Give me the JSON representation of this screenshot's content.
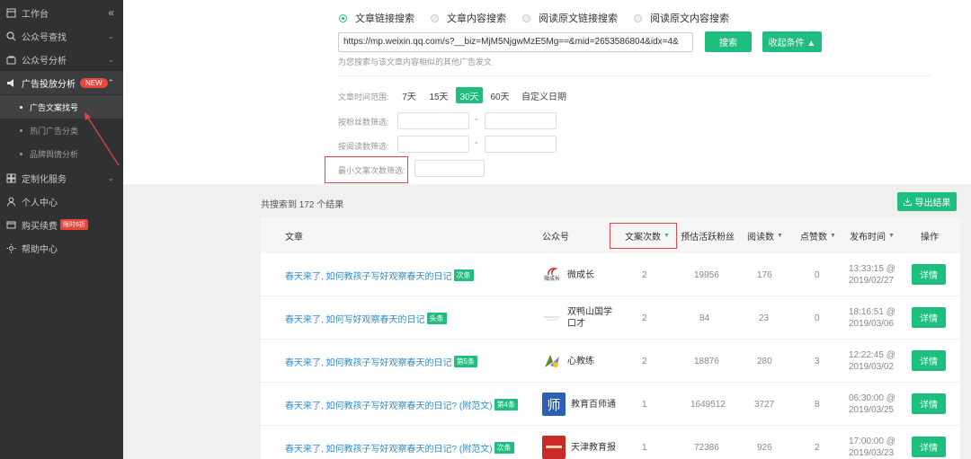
{
  "sidebar": {
    "items": [
      {
        "icon": "workbench-icon",
        "label": "工作台"
      },
      {
        "icon": "search-icon",
        "label": "公众号查找"
      },
      {
        "icon": "analysis-icon",
        "label": "公众号分析"
      },
      {
        "icon": "ad-icon",
        "label": "广告投放分析",
        "badge": "NEW"
      },
      {
        "icon": "custom-service-icon",
        "label": "定制化服务"
      },
      {
        "icon": "user-icon",
        "label": "个人中心"
      },
      {
        "icon": "cart-icon",
        "label": "购买续费",
        "badge": "限时6折"
      },
      {
        "icon": "help-icon",
        "label": "帮助中心"
      }
    ],
    "subitems": [
      {
        "label": "广告文案找号"
      },
      {
        "label": "热门广告分类"
      },
      {
        "label": "品牌舆情分析"
      }
    ],
    "collapse_glyph": "«"
  },
  "search": {
    "modes": [
      "文章链接搜索",
      "文章内容搜索",
      "阅读原文链接搜索",
      "阅读原文内容搜索"
    ],
    "url_value": "https://mp.weixin.qq.com/s?__biz=MjM5NjgwMzE5Mg==&mid=2653586804&idx=4&",
    "search_label": "搜索",
    "collapse_label": "收起条件 ▲",
    "hint": "为您搜索与该文章内容相似的其他广告发文"
  },
  "filters": {
    "time_label": "文章时间范围:",
    "time_options": [
      "7天",
      "15天",
      "30天",
      "60天",
      "自定义日期"
    ],
    "fans_label": "按粉丝数筛选:",
    "reads_label": "按阅读数筛选:",
    "min_copies_label": "最小文案次数筛选:",
    "dash": "-"
  },
  "results": {
    "count_text": "共搜索到 172 个结果",
    "export_label": "导出结果"
  },
  "table": {
    "headers": {
      "article": "文章",
      "account": "公众号",
      "copies": "文案次数",
      "fans": "预估活跃粉丝",
      "reads": "阅读数",
      "likes": "点赞数",
      "published": "发布时间",
      "action": "操作"
    },
    "rows": [
      {
        "title": "春天来了, 如何教孩子写好观察春天的日记",
        "tag": "次条",
        "account": "微成长",
        "avatar_text": "微成长",
        "avatar_color": "#ffffff",
        "copies": "2",
        "fans": "19956",
        "reads": "176",
        "likes": "0",
        "time": "13:33:15 @",
        "date": "2019/02/27",
        "action": "详情"
      },
      {
        "title": "春天来了, 如何写好观察春天的日记",
        "tag": "头条",
        "account": "双鸭山国学",
        "account2": "口才",
        "avatar_text": "",
        "avatar_color": "#ffffff",
        "copies": "2",
        "fans": "84",
        "reads": "23",
        "likes": "0",
        "time": "18:16:51 @",
        "date": "2019/03/06",
        "action": "详情"
      },
      {
        "title": "春天来了, 如何教孩子写好观察春天的日记",
        "tag": "第5条",
        "account": "心教练",
        "avatar_text": "",
        "avatar_color": "#ffffff",
        "copies": "2",
        "fans": "18876",
        "reads": "280",
        "likes": "3",
        "time": "12:22:45 @",
        "date": "2019/03/02",
        "action": "详情"
      },
      {
        "title": "春天来了, 如何教孩子写好观察春天的日记? (附范文)",
        "tag": "第4条",
        "account": "教育百师通",
        "avatar_text": "师",
        "avatar_color": "#2d5fb8",
        "copies": "1",
        "fans": "1649512",
        "reads": "3727",
        "likes": "8",
        "time": "06:30:00 @",
        "date": "2019/03/25",
        "action": "详情"
      },
      {
        "title": "春天来了, 如何教孩子写好观察春天的日记? (附范文)",
        "tag": "次条",
        "account": "天津教育报",
        "avatar_text": "",
        "avatar_color": "#c82a2a",
        "copies": "1",
        "fans": "72386",
        "reads": "926",
        "likes": "2",
        "time": "17:00:00 @",
        "date": "2019/03/23",
        "action": "详情"
      }
    ]
  },
  "colors": {
    "accent": "#1fbe7e",
    "link": "#2a8fcf",
    "sidebar_bg": "#2f3133",
    "highlight_box": "#e24545"
  }
}
